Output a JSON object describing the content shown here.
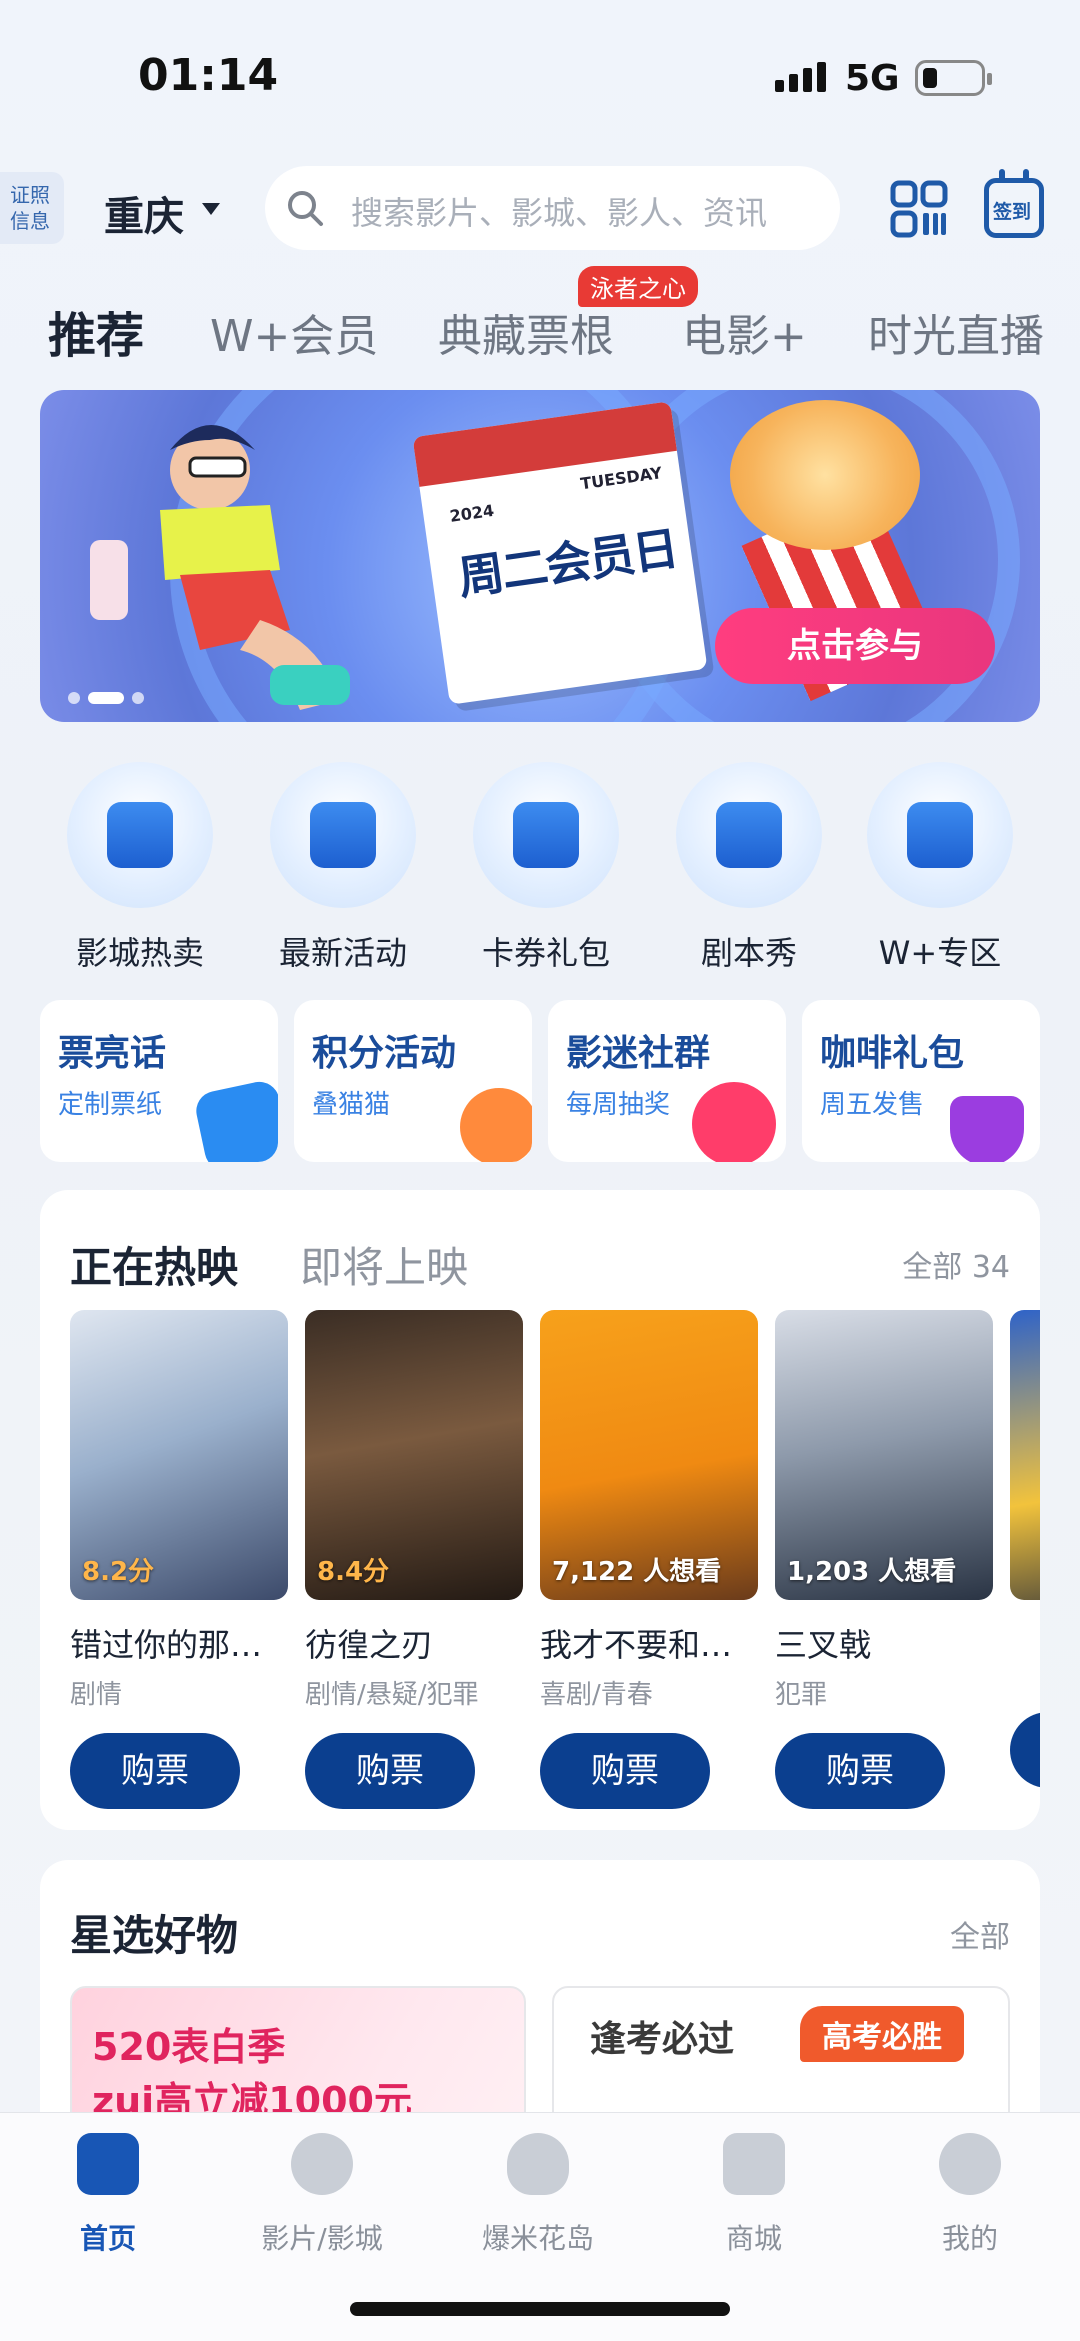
{
  "status_bar": {
    "time": "01:14",
    "network": "5G"
  },
  "header": {
    "license_label": "证照信息",
    "city": "重庆",
    "search_placeholder": "搜索影片、影城、影人、资讯",
    "checkin_label": "签到"
  },
  "tabs": [
    {
      "label": "推荐",
      "active": true
    },
    {
      "label": "W+会员"
    },
    {
      "label": "典藏票根",
      "badge": "泳者之心"
    },
    {
      "label": "电影+"
    },
    {
      "label": "时光直播"
    }
  ],
  "banner": {
    "calendar_year": "2024",
    "calendar_day": "TUESDAY",
    "calendar_title": "周二会员日",
    "cta": "点击参与"
  },
  "quick_links": [
    {
      "label": "影城热卖",
      "icon": "cinema-drink-icon"
    },
    {
      "label": "最新活动",
      "icon": "activity-box-icon"
    },
    {
      "label": "卡券礼包",
      "icon": "ticket-coupon-icon"
    },
    {
      "label": "剧本秀",
      "icon": "detective-icon"
    },
    {
      "label": "W+专区",
      "icon": "crown-icon"
    }
  ],
  "promos": [
    {
      "title": "票亮话",
      "subtitle": "定制票纸",
      "icon": "ticket-icon",
      "color": "#2a8cf2"
    },
    {
      "title": "积分活动",
      "subtitle": "叠猫猫",
      "icon": "star-icon",
      "color": "#ff8a3c"
    },
    {
      "title": "影迷社群",
      "subtitle": "每周抽奖",
      "icon": "chat-bubble-icon",
      "color": "#ff3d6a"
    },
    {
      "title": "咖啡礼包",
      "subtitle": "周五发售",
      "icon": "coffee-icon",
      "color": "#9b3de0"
    }
  ],
  "movies_section": {
    "tab_active": "正在热映",
    "tab_inactive": "即将上映",
    "all_label": "全部 34",
    "buy_label": "购票",
    "movies": [
      {
        "title": "错过你的那…",
        "genre": "剧情",
        "tag": "8.2分",
        "tag_type": "score"
      },
      {
        "title": "彷徨之刃",
        "genre": "剧情/悬疑/犯罪",
        "tag": "8.4分",
        "tag_type": "score"
      },
      {
        "title": "我才不要和…",
        "genre": "喜剧/青春",
        "tag": "7,122 人想看",
        "tag_type": "want"
      },
      {
        "title": "三叉戟",
        "genre": "犯罪",
        "tag": "1,203 人想看",
        "tag_type": "want"
      }
    ]
  },
  "goods_section": {
    "title": "星选好物",
    "all_label": "全部",
    "card1_line1": "520表白季",
    "card1_line2": "zui高立减1000元",
    "card2_title": "逢考必过",
    "card2_tag": "高考必胜"
  },
  "bottom_nav": [
    {
      "label": "首页",
      "icon": "home-icon",
      "active": true
    },
    {
      "label": "影片/影城",
      "icon": "film-reel-icon"
    },
    {
      "label": "爆米花岛",
      "icon": "popcorn-icon"
    },
    {
      "label": "商城",
      "icon": "shopping-bag-icon"
    },
    {
      "label": "我的",
      "icon": "profile-icon"
    }
  ]
}
